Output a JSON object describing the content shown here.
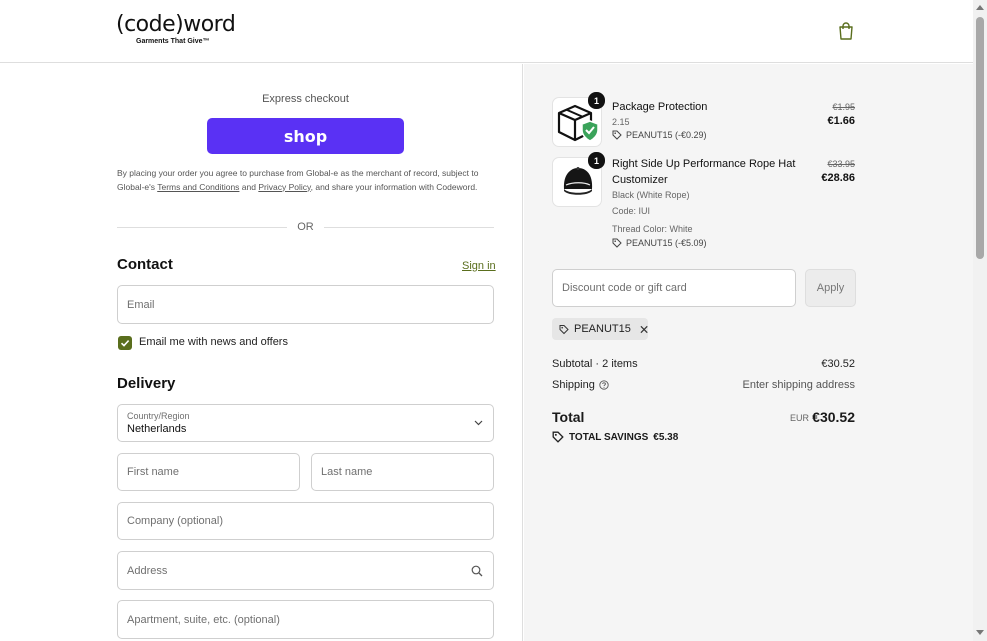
{
  "header": {
    "brand": "(code)word",
    "tagline": "Garments That Give™",
    "cart_icon": "shopping-bag-icon"
  },
  "express": {
    "label": "Express checkout",
    "shop_button": "shop"
  },
  "legal": {
    "prefix": "By placing your order you agree to purchase from Global-e as the merchant of record, subject to Global-e's ",
    "terms_link": "Terms and Conditions",
    "and": " and ",
    "privacy_link": "Privacy Policy",
    "suffix": ", and share your information with Codeword."
  },
  "divider": {
    "or": "OR"
  },
  "contact": {
    "title": "Contact",
    "sign_in": "Sign in",
    "email_placeholder": "Email",
    "newsletter_label": "Email me with news and offers",
    "newsletter_checked": true
  },
  "delivery": {
    "title": "Delivery",
    "country_label": "Country/Region",
    "country_value": "Netherlands",
    "first_name": "First name",
    "last_name": "Last name",
    "company": "Company (optional)",
    "address": "Address",
    "apartment": "Apartment, suite, etc. (optional)"
  },
  "order": {
    "items": [
      {
        "quantity": "1",
        "name": "Package Protection",
        "sub1": "2.15",
        "discount": "PEANUT15 (-€0.29)",
        "price_old": "€1.95",
        "price_new": "€1.66"
      },
      {
        "quantity": "1",
        "name_line1": "Right Side Up Performance Rope Hat",
        "name_line2": "Customizer",
        "sub1": "Black (White Rope)",
        "sub2": "Code: IUI",
        "sub3": "Thread Color: White",
        "discount": "PEANUT15 (-€5.09)",
        "price_old": "€33.95",
        "price_new": "€28.86"
      }
    ],
    "discount_placeholder": "Discount code or gift card",
    "apply": "Apply",
    "applied_code": "PEANUT15",
    "subtotal_label": "Subtotal · 2 items",
    "subtotal_value": "€30.52",
    "shipping_label": "Shipping",
    "shipping_value": "Enter shipping address",
    "total_label": "Total",
    "currency": "EUR",
    "total_value": "€30.52",
    "savings_label": "TOTAL SAVINGS",
    "savings_value": "€5.38"
  },
  "colors": {
    "shop_purple": "#5a31f4",
    "accent_olive": "#5a6e1d",
    "shield_green": "#3aa35a"
  }
}
